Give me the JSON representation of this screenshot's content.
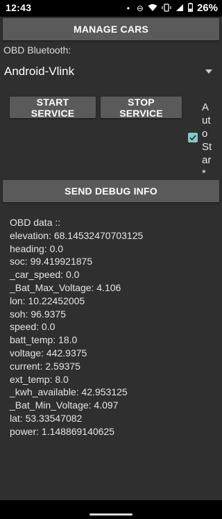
{
  "status_bar": {
    "time": "12:43",
    "battery_percent": "26%",
    "icons": [
      "notification-dot-icon",
      "do-not-disturb-icon",
      "wifi-icon",
      "vibrate-icon",
      "signal-icon",
      "battery-icon"
    ]
  },
  "manage_cars_label": "MANAGE CARS",
  "obd_bluetooth_label": "OBD Bluetooth:",
  "obd_device": {
    "selected": "Android-Vlink"
  },
  "start_service_label": "START SERVICE",
  "stop_service_label": "STOP SERVICE",
  "auto_start": {
    "label": "Auto Star*",
    "checked": true
  },
  "send_debug_label": "SEND DEBUG INFO",
  "obd_data": {
    "title": "OBD data ::",
    "lines": [
      "elevation: 68.14532470703125",
      "heading: 0.0",
      "soc: 99.419921875",
      "_car_speed: 0.0",
      "_Bat_Max_Voltage: 4.106",
      "lon: 10.22452005",
      "soh: 96.9375",
      "speed: 0.0",
      "batt_temp: 18.0",
      "voltage: 442.9375",
      "current: 2.59375",
      "ext_temp: 8.0",
      "_kwh_available: 42.953125",
      "_Bat_Min_Voltage: 4.097",
      "lat: 53.33547082",
      "power: 1.148869140625"
    ]
  },
  "colors": {
    "background": "#2f2f2f",
    "button": "#5a5a5a",
    "checkbox_accent": "#80cbc4",
    "status_bar": "#000000"
  }
}
